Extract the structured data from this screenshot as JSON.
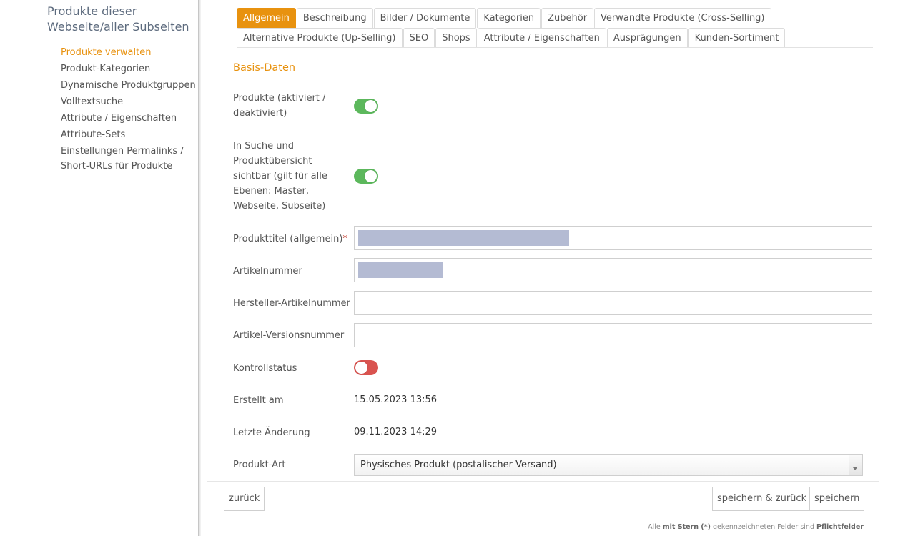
{
  "sidebar": {
    "title": "Produkte dieser Webseite/aller Subseiten",
    "items": [
      {
        "label": "Produkte verwalten",
        "active": true
      },
      {
        "label": "Produkt-Kategorien"
      },
      {
        "label": "Dynamische Produktgruppen"
      },
      {
        "label": "Volltextsuche"
      },
      {
        "label": "Attribute / Eigenschaften"
      },
      {
        "label": "Attribute-Sets"
      },
      {
        "label": "Einstellungen Permalinks / Short-URLs für Produkte"
      }
    ]
  },
  "tabs": {
    "row1": [
      "Allgemein",
      "Beschreibung",
      "Bilder / Dokumente",
      "Kategorien",
      "Zubehör",
      "Verwandte Produkte (Cross-Selling)"
    ],
    "row2": [
      "Alternative Produkte (Up-Selling)",
      "SEO",
      "Shops",
      "Attribute / Eigenschaften",
      "Ausprägungen",
      "Kunden-Sortiment"
    ],
    "active": "Allgemein"
  },
  "form": {
    "section_title": "Basis-Daten",
    "products_active_label": "Produkte (aktiviert / deaktiviert)",
    "products_active": true,
    "visible_label": "In Suche und Produktübersicht sichtbar (gilt für alle Ebenen: Master, Webseite, Subseite)",
    "visible": true,
    "title_label": "Produkttitel (allgemein)",
    "required_mark": "*",
    "article_number_label": "Artikelnummer",
    "manufacturer_number_label": "Hersteller-Artikelnummer",
    "manufacturer_number_value": "",
    "version_number_label": "Artikel-Versionsnummer",
    "version_number_value": "",
    "control_status_label": "Kontrollstatus",
    "control_status": false,
    "created_label": "Erstellt am",
    "created_value": "15.05.2023 13:56",
    "modified_label": "Letzte Änderung",
    "modified_value": "09.11.2023 14:29",
    "product_type_label": "Produkt-Art",
    "product_type_value": "Physisches Produkt (postalischer Versand)"
  },
  "footer": {
    "back_label": "zurück",
    "save_back_label": "speichern & zurück",
    "save_label": "speichern",
    "note_prefix": "Alle",
    "note_bold1": "mit Stern (*)",
    "note_middle": "gekennzeichneten Felder sind",
    "note_bold2": "Pflichtfelder"
  },
  "colors": {
    "accent": "#e8920f",
    "toggle_on": "#5cb85c",
    "toggle_off": "#d9534f",
    "redaction": "#b4bbd3"
  }
}
